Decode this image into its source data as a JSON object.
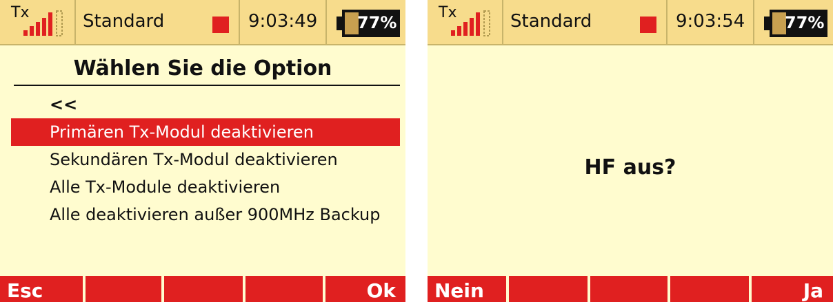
{
  "colors": {
    "screen_bg": "#fffccf",
    "statusbar_bg": "#f7dc8c",
    "accent_red": "#e02020",
    "text": "#111111"
  },
  "left_screen": {
    "statusbar": {
      "tx_label": "Tx",
      "tx_signal_icon": "signal-bars-icon",
      "model_name": "Standard",
      "clock": "9:03:49",
      "battery_percent": "77%",
      "battery_level": 0.77
    },
    "title": "Wählen Sie die Option",
    "menu": [
      {
        "label": "<<",
        "selected": false
      },
      {
        "label": "Primären Tx-Modul deaktivieren",
        "selected": true
      },
      {
        "label": "Sekundären Tx-Modul deaktivieren",
        "selected": false
      },
      {
        "label": "Alle Tx-Module deaktivieren",
        "selected": false
      },
      {
        "label": "Alle deaktivieren außer 900MHz Backup",
        "selected": false
      }
    ],
    "softkeys": [
      "Esc",
      "",
      "",
      "",
      "Ok"
    ]
  },
  "right_screen": {
    "statusbar": {
      "tx_label": "Tx",
      "tx_signal_icon": "signal-bars-icon",
      "model_name": "Standard",
      "clock": "9:03:54",
      "battery_percent": "77%",
      "battery_level": 0.77
    },
    "message": "HF aus?",
    "softkeys": [
      "Nein",
      "",
      "",
      "",
      "Ja"
    ]
  }
}
